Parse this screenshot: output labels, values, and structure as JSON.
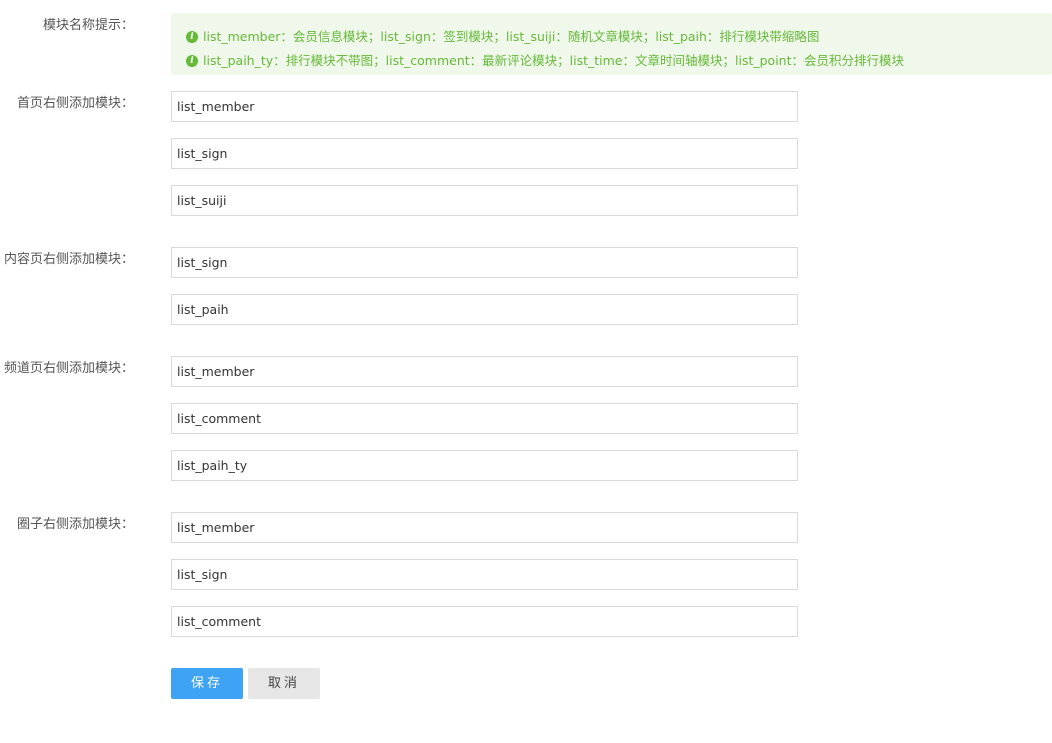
{
  "hint": {
    "label": "模块名称提示：",
    "lines": [
      "list_member：会员信息模块；list_sign：签到模块；list_suiji：随机文章模块；list_paih：排行模块带缩略图",
      "list_paih_ty：排行模块不带图；list_comment：最新评论模块；list_time：文章时间轴模块；list_point：会员积分排行模块"
    ],
    "icon": "info-icon",
    "color": "#67b93a",
    "background": "#eff8ea"
  },
  "sections": [
    {
      "label": "首页右侧添加模块：",
      "inputs": [
        "list_member",
        "list_sign",
        "list_suiji"
      ]
    },
    {
      "label": "内容页右侧添加模块：",
      "inputs": [
        "list_sign",
        "list_paih"
      ]
    },
    {
      "label": "频道页右侧添加模块：",
      "inputs": [
        "list_member",
        "list_comment",
        "list_paih_ty"
      ]
    },
    {
      "label": "圈子右侧添加模块：",
      "inputs": [
        "list_member",
        "list_sign",
        "list_comment"
      ]
    }
  ],
  "buttons": {
    "save": "保存",
    "cancel": "取消"
  },
  "colors": {
    "primary": "#3ea2f5",
    "secondary": "#e6e6e6"
  }
}
